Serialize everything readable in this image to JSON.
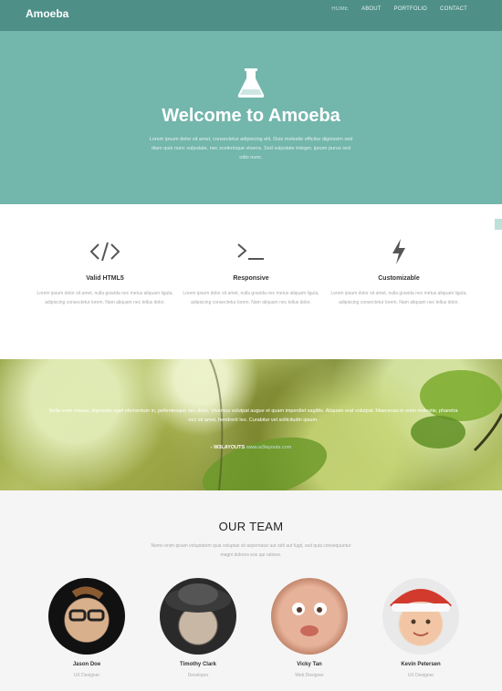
{
  "nav": {
    "brand": "Amoeba",
    "items": [
      "HOME",
      "ABOUT",
      "PORTFOLIO",
      "CONTACT"
    ]
  },
  "hero": {
    "icon": "flask-icon",
    "title": "Welcome to Amoeba",
    "text": "Lorem ipsum dolor sit amet, consectetur adipiscing elit. Duis molestie efficitur dignissim sed diam quis nunc vulputate, nec scelerisque viverra. Sed vulputate integer, ipsum purus sed odio nunc."
  },
  "features": [
    {
      "icon": "code-icon",
      "title": "Valid HTML5",
      "text": "Lorem ipsum dolor sit amet, nulla gravida nec metus aliquam ligula, adipiscing consectetur lorem. Nam aliquam nec tellus dolor."
    },
    {
      "icon": "terminal-icon",
      "title": "Responsive",
      "text": "Lorem ipsum dolor sit amet, nulla gravida nec metus aliquam ligula, adipiscing consectetur lorem. Nam aliquam nec tellus dolor."
    },
    {
      "icon": "bolt-icon",
      "title": "Customizable",
      "text": "Lorem ipsum dolor sit amet, nulla gravida nec metus aliquam ligula, adipiscing consectetur lorem. Nam aliquam nec tellus dolor."
    }
  ],
  "parallax": {
    "quote": "Nulla enim massa, dignissim eget elementum in, pellentesque nec dolor. Vivamus volutpat augue et quam imperdiet sagittis. Aliquam erat volutpat. Maecenas in enim molestie, pharetra orci sit amet, hendrerit leo. Curabitur vel sollicitudin ipsum.",
    "attribution_name": "- W3LAYOUTS",
    "attribution_link": "www.w3layouts.com"
  },
  "team": {
    "title": "OUR TEAM",
    "intro": "Nemo enim ipsam voluptatem quia voluptas sit aspernatur aut odit aut fugit, sed quia consequuntur magni dolores eos qui ratione.",
    "members": [
      {
        "name": "Jason Doe",
        "role": "UX Designer"
      },
      {
        "name": "Timothy Clark",
        "role": "Developer"
      },
      {
        "name": "Vicky Tan",
        "role": "Web Designer"
      },
      {
        "name": "Kevin Petersen",
        "role": "UX Designer"
      }
    ]
  },
  "colors": {
    "nav": "#4e8f87",
    "hero": "#73b6ac",
    "accent": "#bfe3de"
  }
}
